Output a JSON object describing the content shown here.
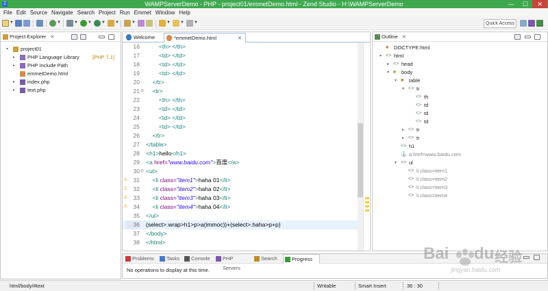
{
  "window": {
    "title": "WAMPServerDemo - PHP - project01/emmetDemo.html - Zend Studio - H:\\WAMPServerDemo",
    "minimize": "—",
    "maximize": "☐",
    "close": "✕"
  },
  "menu": [
    "File",
    "Edit",
    "Source",
    "Navigate",
    "Search",
    "Project",
    "Run",
    "Emmet",
    "Window",
    "Help"
  ],
  "toolbar": {
    "quick_access": "Quick Access"
  },
  "project_explorer": {
    "title": "Project Explorer",
    "items": [
      {
        "label": "project01",
        "twisty": "▾",
        "icon": "project-icon",
        "color": "#c8a040"
      },
      {
        "label": "PHP Language Library",
        "extra": "[PHP 7.1]",
        "twisty": "▸",
        "icon": "library-icon",
        "color": "#8a6bb8"
      },
      {
        "label": "PHP Include Path",
        "twisty": "▸",
        "icon": "library-icon",
        "color": "#8a6bb8"
      },
      {
        "label": "emmetDemo.html",
        "twisty": "",
        "icon": "html-file-icon",
        "color": "#d88a4a"
      },
      {
        "label": "index.php",
        "twisty": "▸",
        "icon": "php-file-icon",
        "color": "#7a5aa8"
      },
      {
        "label": "text.php",
        "twisty": "▸",
        "icon": "php-file-icon",
        "color": "#7a5aa8"
      }
    ]
  },
  "editor": {
    "tabs": [
      {
        "label": "Welcome",
        "close": ""
      },
      {
        "label": "*emmetDemo.html",
        "close": "✕"
      }
    ],
    "lines": [
      {
        "n": "16",
        "fold": "",
        "warn": false,
        "cur": false,
        "parts": [
          [
            "x",
            "        "
          ],
          [
            "t",
            "<th>"
          ],
          [
            "x",
            " "
          ],
          [
            "t",
            "</th>"
          ]
        ]
      },
      {
        "n": "17",
        "fold": "",
        "warn": false,
        "cur": false,
        "parts": [
          [
            "x",
            "        "
          ],
          [
            "t",
            "<td>"
          ],
          [
            "x",
            " "
          ],
          [
            "t",
            "</td>"
          ]
        ]
      },
      {
        "n": "18",
        "fold": "",
        "warn": false,
        "cur": false,
        "parts": [
          [
            "x",
            "        "
          ],
          [
            "t",
            "<td>"
          ],
          [
            "x",
            " "
          ],
          [
            "t",
            "</td>"
          ]
        ]
      },
      {
        "n": "19",
        "fold": "",
        "warn": false,
        "cur": false,
        "parts": [
          [
            "x",
            "        "
          ],
          [
            "t",
            "<td>"
          ],
          [
            "x",
            " "
          ],
          [
            "t",
            "</td>"
          ]
        ]
      },
      {
        "n": "20",
        "fold": "",
        "warn": false,
        "cur": false,
        "parts": [
          [
            "x",
            "    "
          ],
          [
            "t",
            "</tr>"
          ]
        ]
      },
      {
        "n": "21",
        "fold": "⊖",
        "warn": false,
        "cur": false,
        "parts": [
          [
            "x",
            "    "
          ],
          [
            "t",
            "<tr>"
          ]
        ]
      },
      {
        "n": "22",
        "fold": "",
        "warn": false,
        "cur": false,
        "parts": [
          [
            "x",
            "        "
          ],
          [
            "t",
            "<th>"
          ],
          [
            "x",
            " "
          ],
          [
            "t",
            "</th>"
          ]
        ]
      },
      {
        "n": "23",
        "fold": "",
        "warn": false,
        "cur": false,
        "parts": [
          [
            "x",
            "        "
          ],
          [
            "t",
            "<td>"
          ],
          [
            "x",
            " "
          ],
          [
            "t",
            "</td>"
          ]
        ]
      },
      {
        "n": "24",
        "fold": "",
        "warn": false,
        "cur": false,
        "parts": [
          [
            "x",
            "        "
          ],
          [
            "t",
            "<td>"
          ],
          [
            "x",
            " "
          ],
          [
            "t",
            "</td>"
          ]
        ]
      },
      {
        "n": "25",
        "fold": "",
        "warn": false,
        "cur": false,
        "parts": [
          [
            "x",
            "        "
          ],
          [
            "t",
            "<td>"
          ],
          [
            "x",
            " "
          ],
          [
            "t",
            "</td>"
          ]
        ]
      },
      {
        "n": "26",
        "fold": "",
        "warn": false,
        "cur": false,
        "parts": [
          [
            "x",
            "    "
          ],
          [
            "t",
            "</tr>"
          ]
        ]
      },
      {
        "n": "27",
        "fold": "",
        "warn": false,
        "cur": false,
        "parts": [
          [
            "t",
            "</table>"
          ]
        ]
      },
      {
        "n": "28",
        "fold": "",
        "warn": false,
        "cur": false,
        "parts": [
          [
            "t",
            "<h1>"
          ],
          [
            "x",
            "hello"
          ],
          [
            "t",
            "</h1>"
          ]
        ]
      },
      {
        "n": "29",
        "fold": "",
        "warn": false,
        "cur": false,
        "parts": [
          [
            "t",
            "<a "
          ],
          [
            "a",
            "href="
          ],
          [
            "s",
            "\"www.baidu.com\""
          ],
          [
            "t",
            ">"
          ],
          [
            "x",
            "百度"
          ],
          [
            "t",
            "</a>"
          ]
        ]
      },
      {
        "n": "30",
        "fold": "⊖",
        "warn": false,
        "cur": false,
        "parts": [
          [
            "t",
            "<ul>"
          ]
        ]
      },
      {
        "n": "31",
        "fold": "",
        "warn": true,
        "cur": false,
        "parts": [
          [
            "x",
            "    "
          ],
          [
            "t",
            "<li "
          ],
          [
            "a",
            "class="
          ],
          [
            "s",
            "\"item1\""
          ],
          [
            "t",
            ">"
          ],
          [
            "x",
            "haha 01"
          ],
          [
            "t",
            "</li>"
          ]
        ]
      },
      {
        "n": "32",
        "fold": "",
        "warn": true,
        "cur": false,
        "parts": [
          [
            "x",
            "    "
          ],
          [
            "t",
            "<li "
          ],
          [
            "a",
            "class="
          ],
          [
            "s",
            "\"item2\""
          ],
          [
            "t",
            ">"
          ],
          [
            "x",
            "haha 02"
          ],
          [
            "t",
            "</li>"
          ]
        ]
      },
      {
        "n": "33",
        "fold": "",
        "warn": true,
        "cur": false,
        "parts": [
          [
            "x",
            "    "
          ],
          [
            "t",
            "<li "
          ],
          [
            "a",
            "class="
          ],
          [
            "s",
            "\"item3\""
          ],
          [
            "t",
            ">"
          ],
          [
            "x",
            "haha 03"
          ],
          [
            "t",
            "</li>"
          ]
        ]
      },
      {
        "n": "34",
        "fold": "",
        "warn": true,
        "cur": false,
        "parts": [
          [
            "x",
            "    "
          ],
          [
            "t",
            "<li "
          ],
          [
            "a",
            "class="
          ],
          [
            "s",
            "\"item4\""
          ],
          [
            "t",
            ">"
          ],
          [
            "x",
            "haha 04"
          ],
          [
            "t",
            "</li>"
          ]
        ]
      },
      {
        "n": "35",
        "fold": "",
        "warn": false,
        "cur": false,
        "parts": [
          [
            "t",
            "</ul>"
          ]
        ]
      },
      {
        "n": "36",
        "fold": "",
        "warn": false,
        "cur": true,
        "parts": [
          [
            "x",
            "(select>.wrap>h1>p>a(immoc))+(select>.haha>p+p)"
          ]
        ]
      },
      {
        "n": "37",
        "fold": "",
        "warn": false,
        "cur": false,
        "parts": [
          [
            "t",
            "</body>"
          ]
        ]
      },
      {
        "n": "38",
        "fold": "",
        "warn": false,
        "cur": false,
        "parts": [
          [
            "t",
            "</html>"
          ]
        ]
      }
    ]
  },
  "outline": {
    "title": "Outline",
    "items": [
      {
        "label": "DOCTYPE:html",
        "twisty": "",
        "icon": "doctype-icon",
        "depth": 0,
        "muted": false
      },
      {
        "label": "html",
        "twisty": "▾",
        "icon": "element-icon",
        "depth": 0,
        "muted": false
      },
      {
        "label": "head",
        "twisty": "▸",
        "icon": "element-icon",
        "depth": 1,
        "muted": false
      },
      {
        "label": "body",
        "twisty": "▾",
        "icon": "body-icon",
        "depth": 1,
        "muted": false
      },
      {
        "label": "table",
        "twisty": "▾",
        "icon": "table-icon",
        "depth": 2,
        "muted": false
      },
      {
        "label": "tr",
        "twisty": "▾",
        "icon": "element-icon",
        "depth": 3,
        "muted": false
      },
      {
        "label": "th",
        "twisty": "",
        "icon": "element-icon",
        "depth": 4,
        "muted": false
      },
      {
        "label": "td",
        "twisty": "",
        "icon": "element-icon",
        "depth": 4,
        "muted": false
      },
      {
        "label": "td",
        "twisty": "",
        "icon": "element-icon",
        "depth": 4,
        "muted": false
      },
      {
        "label": "td",
        "twisty": "",
        "icon": "element-icon",
        "depth": 4,
        "muted": false
      },
      {
        "label": "tr",
        "twisty": "▸",
        "icon": "element-icon",
        "depth": 3,
        "muted": false
      },
      {
        "label": "tr",
        "twisty": "▸",
        "icon": "element-icon",
        "depth": 3,
        "muted": false
      },
      {
        "label": "h1",
        "twisty": "",
        "icon": "element-icon",
        "depth": 2,
        "muted": false
      },
      {
        "label": "a href=www.baidu.com",
        "twisty": "",
        "icon": "anchor-icon",
        "depth": 2,
        "muted": true
      },
      {
        "label": "ul",
        "twisty": "▾",
        "icon": "element-icon",
        "depth": 2,
        "muted": false
      },
      {
        "label": "li class=item1",
        "twisty": "",
        "icon": "element-icon",
        "depth": 3,
        "muted": true
      },
      {
        "label": "li class=item2",
        "twisty": "",
        "icon": "element-icon",
        "depth": 3,
        "muted": true
      },
      {
        "label": "li class=item3",
        "twisty": "",
        "icon": "element-icon",
        "depth": 3,
        "muted": true
      },
      {
        "label": "li class=item4",
        "twisty": "",
        "icon": "element-icon",
        "depth": 3,
        "muted": true
      }
    ]
  },
  "bottom": {
    "tabs": [
      {
        "label": "Problems",
        "icon": "problems-icon",
        "color": "#c04040",
        "active": false
      },
      {
        "label": "Tasks",
        "icon": "tasks-icon",
        "color": "#4a7ac0",
        "active": false
      },
      {
        "label": "Console",
        "icon": "console-icon",
        "color": "#555",
        "active": false
      },
      {
        "label": "PHP Servers",
        "icon": "server-icon",
        "color": "#7a5aa8",
        "active": false
      },
      {
        "label": "Search",
        "icon": "search-icon",
        "color": "#c08a30",
        "active": false
      },
      {
        "label": "Progress",
        "icon": "progress-icon",
        "color": "#3a9a3a",
        "active": true
      }
    ],
    "content": "No operations to display at this time."
  },
  "status": {
    "path": "html/body/#text",
    "mode": "Writable",
    "insert": "Smart Insert",
    "position": "36 : 30"
  },
  "watermark": {
    "brand": "Bai",
    "brand2": "du",
    "brand3": "经验",
    "url": "jingyan.baidu.com"
  },
  "colors": {
    "title_bar": "#3ea84f",
    "tag": "#17817b",
    "attr": "#7f007f",
    "string": "#2a00ff",
    "selection": "#e8f2fe"
  }
}
